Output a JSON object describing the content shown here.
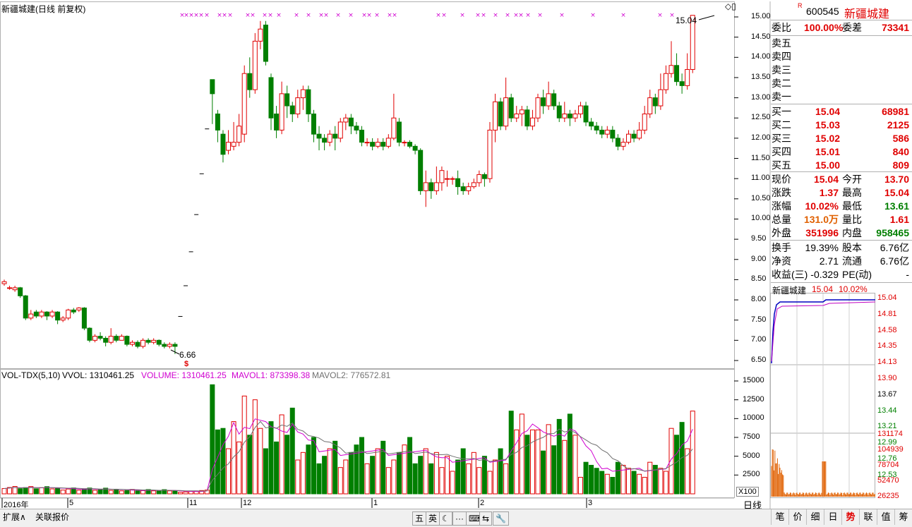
{
  "chart_title": "新疆城建(日线 前复权)",
  "stock": {
    "r_flag": "R",
    "code": "600545",
    "name": "新疆城建"
  },
  "price_axis": [
    "15.00",
    "14.50",
    "14.00",
    "13.50",
    "13.00",
    "12.50",
    "12.00",
    "11.50",
    "11.00",
    "10.50",
    "10.00",
    "9.50",
    "9.00",
    "8.50",
    "8.00",
    "7.50",
    "7.00",
    "6.50"
  ],
  "price_label_high": "15.04",
  "price_label_low": "6.66",
  "volume_legend": {
    "label": "VOL-TDX(5,10)",
    "vvol": "VVOL: 1310461.25",
    "volume": "VOLUME: 1310461.25",
    "mavol1": "MAVOL1: 873398.38",
    "mavol2": "MAVOL2: 776572.81"
  },
  "volume_axis": [
    "15000",
    "12500",
    "10000",
    "7500",
    "5000",
    "2500"
  ],
  "volume_x_label": "X100",
  "date_axis": [
    {
      "label": "2016年",
      "x": 5
    },
    {
      "label": "5",
      "x": 98
    },
    {
      "label": "11",
      "x": 268
    },
    {
      "label": "12",
      "x": 344
    },
    {
      "label": "1",
      "x": 529
    },
    {
      "label": "2",
      "x": 680
    },
    {
      "label": "3",
      "x": 833
    }
  ],
  "period_label": "日线",
  "bottom_left": {
    "expand": "扩展∧",
    "related": "关联报价"
  },
  "center_toolbar": [
    "五",
    "英",
    "☾",
    "···",
    "⌨",
    "⇆",
    "🔧"
  ],
  "quote": {
    "weibi_label": "委比",
    "weibi": "100.00%",
    "weicha_label": "委差",
    "weicha": "73341",
    "sell": [
      {
        "label": "卖五"
      },
      {
        "label": "卖四"
      },
      {
        "label": "卖三"
      },
      {
        "label": "卖二"
      },
      {
        "label": "卖一"
      }
    ],
    "buy": [
      {
        "label": "买一",
        "price": "15.04",
        "vol": "68981"
      },
      {
        "label": "买二",
        "price": "15.03",
        "vol": "2125"
      },
      {
        "label": "买三",
        "price": "15.02",
        "vol": "586"
      },
      {
        "label": "买四",
        "price": "15.01",
        "vol": "840"
      },
      {
        "label": "买五",
        "price": "15.00",
        "vol": "809"
      }
    ],
    "stats": [
      {
        "l1": "现价",
        "v1": "15.04",
        "c1": "red",
        "l2": "今开",
        "v2": "13.70",
        "c2": "red"
      },
      {
        "l1": "涨跌",
        "v1": "1.37",
        "c1": "red",
        "l2": "最高",
        "v2": "15.04",
        "c2": "red"
      },
      {
        "l1": "涨幅",
        "v1": "10.02%",
        "c1": "red",
        "l2": "最低",
        "v2": "13.61",
        "c2": "green"
      },
      {
        "l1": "总量",
        "v1": "131.0万",
        "c1": "orange",
        "l2": "量比",
        "v2": "1.61",
        "c2": "red"
      },
      {
        "l1": "外盘",
        "v1": "351996",
        "c1": "red",
        "l2": "内盘",
        "v2": "958465",
        "c2": "green"
      }
    ],
    "stats2": [
      {
        "l1": "换手",
        "v1": "19.39%",
        "l2": "股本",
        "v2": "6.76亿"
      },
      {
        "l1": "净资",
        "v1": "2.71",
        "l2": "流通",
        "v2": "6.76亿"
      },
      {
        "l1": "收益(三)",
        "v1": "-0.329",
        "l2": "PE(动)",
        "v2": "-"
      }
    ]
  },
  "mini_chart": {
    "name": "新疆城建",
    "price": "15.04",
    "pct": "10.02%",
    "axis_up": [
      "15.04",
      "14.81",
      "14.58",
      "14.35",
      "14.13",
      "13.90"
    ],
    "axis_mid": "13.67",
    "axis_down": [
      "13.44",
      "13.21",
      "12.99",
      "12.76",
      "12.53"
    ],
    "vol_axis": [
      "131174",
      "104939",
      "78704",
      "52470",
      "26235"
    ]
  },
  "right_tabs": [
    "笔",
    "价",
    "细",
    "日",
    "势",
    "联",
    "值",
    "筹"
  ],
  "colors": {
    "up": "#e00000",
    "down": "#007f00",
    "ma1": "#d000d0",
    "ma2": "#707070",
    "axis": "#000000"
  },
  "chart_data": {
    "type": "candlestick",
    "ylim": [
      6.3,
      15.2
    ],
    "candles": [
      [
        8.4,
        8.45,
        8.5,
        8.35
      ],
      [
        8.3,
        8.3,
        8.35,
        8.25
      ],
      [
        8.25,
        8.3,
        8.35,
        8.2
      ],
      [
        8.3,
        8.1,
        8.32,
        8.05
      ],
      [
        8.1,
        7.55,
        8.12,
        7.5
      ],
      [
        7.55,
        7.65,
        7.75,
        7.5
      ],
      [
        7.7,
        7.6,
        7.75,
        7.55
      ],
      [
        7.6,
        7.7,
        7.75,
        7.55
      ],
      [
        7.7,
        7.6,
        7.72,
        7.5
      ],
      [
        7.6,
        7.7,
        7.75,
        7.55
      ],
      [
        7.7,
        7.5,
        7.72,
        7.4
      ],
      [
        7.5,
        7.55,
        7.6,
        7.45
      ],
      [
        7.55,
        7.75,
        7.78,
        7.5
      ],
      [
        7.75,
        7.7,
        7.8,
        7.65
      ],
      [
        7.75,
        7.8,
        7.82,
        7.7
      ],
      [
        7.8,
        7.3,
        7.82,
        7.25
      ],
      [
        7.3,
        7.0,
        7.32,
        6.95
      ],
      [
        7.0,
        7.1,
        7.15,
        6.95
      ],
      [
        7.1,
        7.05,
        7.2,
        7.0
      ],
      [
        7.05,
        6.95,
        7.1,
        6.85
      ],
      [
        6.95,
        7.1,
        7.3,
        6.9
      ],
      [
        7.1,
        7.0,
        7.15,
        6.95
      ],
      [
        7.0,
        7.1,
        7.15,
        7.0
      ],
      [
        7.1,
        6.9,
        7.12,
        6.85
      ],
      [
        6.9,
        6.95,
        7.0,
        6.85
      ],
      [
        6.95,
        6.85,
        7.0,
        6.8
      ],
      [
        6.85,
        7.0,
        7.05,
        6.8
      ],
      [
        7.0,
        6.95,
        7.05,
        6.9
      ],
      [
        6.95,
        7.0,
        7.05,
        6.9
      ],
      [
        7.0,
        6.9,
        7.02,
        6.85
      ],
      [
        6.9,
        6.85,
        6.95,
        6.8
      ],
      [
        6.85,
        6.9,
        6.95,
        6.8
      ],
      [
        6.9,
        6.85,
        6.95,
        6.66
      ],
      [
        7.59,
        7.59,
        7.59,
        7.59
      ],
      [
        8.35,
        8.35,
        8.35,
        8.35
      ],
      [
        9.19,
        9.19,
        9.19,
        9.19
      ],
      [
        10.11,
        10.11,
        10.11,
        10.11
      ],
      [
        11.12,
        11.12,
        11.12,
        11.12
      ],
      [
        12.23,
        12.23,
        12.23,
        12.23
      ],
      [
        13.45,
        13.1,
        13.45,
        12.35
      ],
      [
        12.6,
        12.2,
        12.7,
        11.9
      ],
      [
        12.1,
        11.6,
        12.2,
        11.4
      ],
      [
        11.7,
        11.9,
        12.2,
        11.6
      ],
      [
        11.8,
        11.9,
        12.4,
        11.7
      ],
      [
        11.9,
        12.3,
        12.6,
        11.8
      ],
      [
        12.1,
        13.6,
        13.8,
        11.9
      ],
      [
        13.6,
        13.2,
        14.0,
        13.0
      ],
      [
        13.2,
        14.4,
        14.6,
        13.1
      ],
      [
        14.4,
        14.7,
        14.9,
        14.2
      ],
      [
        14.8,
        13.9,
        14.9,
        13.8
      ],
      [
        13.5,
        12.5,
        13.6,
        12.2
      ],
      [
        12.6,
        12.2,
        12.8,
        12.0
      ],
      [
        12.2,
        13.1,
        13.4,
        12.1
      ],
      [
        13.1,
        12.8,
        13.3,
        12.5
      ],
      [
        12.8,
        12.6,
        12.9,
        12.4
      ],
      [
        12.6,
        13.0,
        13.2,
        12.5
      ],
      [
        13.0,
        13.2,
        13.3,
        12.7
      ],
      [
        13.2,
        12.6,
        13.3,
        12.4
      ],
      [
        12.6,
        12.1,
        12.7,
        11.9
      ],
      [
        12.1,
        12.0,
        12.3,
        11.7
      ],
      [
        12.0,
        11.9,
        12.1,
        11.7
      ],
      [
        11.9,
        12.1,
        12.2,
        11.8
      ],
      [
        12.1,
        12.0,
        12.3,
        11.7
      ],
      [
        12.0,
        12.4,
        12.5,
        11.9
      ],
      [
        12.4,
        12.5,
        12.6,
        12.2
      ],
      [
        12.5,
        12.3,
        12.6,
        12.1
      ],
      [
        12.3,
        12.2,
        12.4,
        12.1
      ],
      [
        12.2,
        11.9,
        12.3,
        11.8
      ],
      [
        11.9,
        11.9,
        12.0,
        11.8
      ],
      [
        11.9,
        11.8,
        12.0,
        11.7
      ],
      [
        11.8,
        11.9,
        12.0,
        11.75
      ],
      [
        11.9,
        11.8,
        12.0,
        11.7
      ],
      [
        11.8,
        12.0,
        12.1,
        11.75
      ],
      [
        12.0,
        12.5,
        13.1,
        11.95
      ],
      [
        12.4,
        11.9,
        12.5,
        11.8
      ],
      [
        11.9,
        11.9,
        11.95,
        11.8
      ],
      [
        11.9,
        11.8,
        11.95,
        11.75
      ],
      [
        11.8,
        11.7,
        11.85,
        11.6
      ],
      [
        11.7,
        10.7,
        11.75,
        10.6
      ],
      [
        10.7,
        10.9,
        11.2,
        10.3
      ],
      [
        10.9,
        10.7,
        11.0,
        10.5
      ],
      [
        10.7,
        10.9,
        11.3,
        10.6
      ],
      [
        10.9,
        11.2,
        11.3,
        10.7
      ],
      [
        11.0,
        11.0,
        11.2,
        10.8
      ],
      [
        11.0,
        11.0,
        11.05,
        10.85
      ],
      [
        11.0,
        10.8,
        11.2,
        10.6
      ],
      [
        10.8,
        10.7,
        10.9,
        10.6
      ],
      [
        10.7,
        10.8,
        10.9,
        10.6
      ],
      [
        10.8,
        10.9,
        11.0,
        10.75
      ],
      [
        10.9,
        11.1,
        11.2,
        10.8
      ],
      [
        11.1,
        11.0,
        11.15,
        10.8
      ],
      [
        11.0,
        12.2,
        12.4,
        10.9
      ],
      [
        12.2,
        12.9,
        13.1,
        11.9
      ],
      [
        12.9,
        12.3,
        13.0,
        12.2
      ],
      [
        12.3,
        13.0,
        13.5,
        12.2
      ],
      [
        13.0,
        12.5,
        13.1,
        12.4
      ],
      [
        12.5,
        12.6,
        12.8,
        12.4
      ],
      [
        12.6,
        12.7,
        12.8,
        12.3
      ],
      [
        12.7,
        12.3,
        12.8,
        12.2
      ],
      [
        12.3,
        12.5,
        12.7,
        12.2
      ],
      [
        12.5,
        13.0,
        13.1,
        12.4
      ],
      [
        13.0,
        12.8,
        13.2,
        12.6
      ],
      [
        12.8,
        13.1,
        13.4,
        12.7
      ],
      [
        13.1,
        12.8,
        13.2,
        12.7
      ],
      [
        12.8,
        12.5,
        12.9,
        12.4
      ],
      [
        12.5,
        12.6,
        12.9,
        12.4
      ],
      [
        12.6,
        12.5,
        12.7,
        12.3
      ],
      [
        12.5,
        12.6,
        12.7,
        12.4
      ],
      [
        12.6,
        12.8,
        12.9,
        12.5
      ],
      [
        12.8,
        12.4,
        12.9,
        12.3
      ],
      [
        12.4,
        12.3,
        12.5,
        12.2
      ],
      [
        12.3,
        12.2,
        12.4,
        12.1
      ],
      [
        12.2,
        12.1,
        12.3,
        12.0
      ],
      [
        12.1,
        12.2,
        12.3,
        12.0
      ],
      [
        12.2,
        12.0,
        12.3,
        11.9
      ],
      [
        12.0,
        11.8,
        12.1,
        11.7
      ],
      [
        11.8,
        11.9,
        12.0,
        11.7
      ],
      [
        11.9,
        12.1,
        12.2,
        11.85
      ],
      [
        12.1,
        12.0,
        12.2,
        11.9
      ],
      [
        12.0,
        12.2,
        12.4,
        11.95
      ],
      [
        12.2,
        12.6,
        12.8,
        12.1
      ],
      [
        12.6,
        13.0,
        13.2,
        12.5
      ],
      [
        13.0,
        12.8,
        13.1,
        12.6
      ],
      [
        12.8,
        13.2,
        13.6,
        12.7
      ],
      [
        13.2,
        13.6,
        13.8,
        13.1
      ],
      [
        13.6,
        13.8,
        14.4,
        13.5
      ],
      [
        13.8,
        13.4,
        14.1,
        13.3
      ],
      [
        13.4,
        13.3,
        13.6,
        13.1
      ],
      [
        13.3,
        13.7,
        14.1,
        13.2
      ],
      [
        13.7,
        15.04,
        15.04,
        13.61
      ]
    ]
  }
}
